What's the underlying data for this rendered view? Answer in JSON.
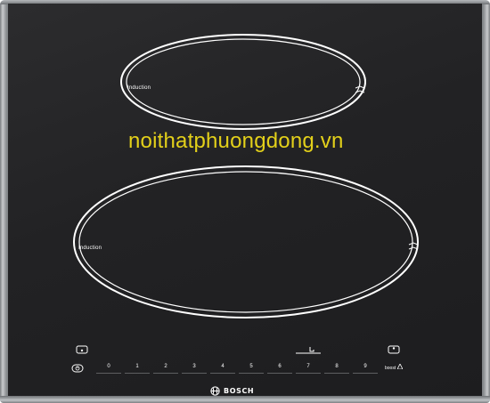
{
  "appliance": {
    "brand": "BOSCH",
    "surface_color": "#222224",
    "trim_color": "#8c8f92"
  },
  "zones": [
    {
      "label": "Induction"
    },
    {
      "label": "Induction"
    }
  ],
  "watermark": {
    "text": "noithatphuongdong.vn",
    "color": "#e3d01a"
  },
  "controls": {
    "power_icon": "power-icon",
    "timer_icon": "timer-icon",
    "wipe_icon": "wipe-protection-icon",
    "lock_icon": "child-lock-icon",
    "left_zone_icon": "zone-select-icon",
    "right_zone_icon": "zone-select-icon",
    "digits": [
      "0",
      "1",
      "2",
      "3",
      "4",
      "5",
      "6",
      "7",
      "8",
      "9"
    ],
    "boost_label": "boost"
  }
}
